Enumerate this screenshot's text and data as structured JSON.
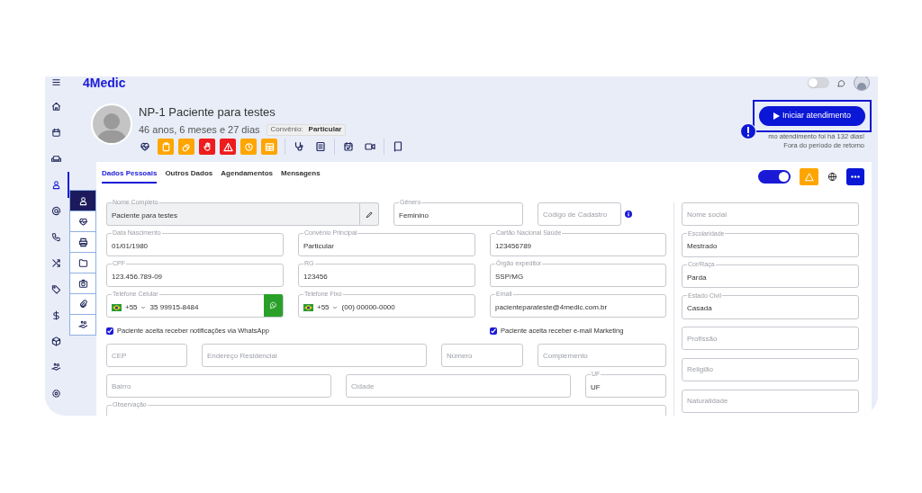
{
  "app": {
    "logo": "4Medic"
  },
  "sidebar": {
    "items": [
      {
        "kind": "menu",
        "selected": false
      },
      {
        "kind": "home",
        "selected": false
      },
      {
        "kind": "calendar",
        "selected": false
      },
      {
        "kind": "sofa",
        "selected": false
      },
      {
        "kind": "user",
        "selected": true
      },
      {
        "kind": "at",
        "selected": false
      },
      {
        "kind": "phone",
        "selected": false
      },
      {
        "kind": "shuffle",
        "selected": false
      },
      {
        "kind": "tag",
        "selected": false
      },
      {
        "kind": "dollar",
        "selected": false
      },
      {
        "kind": "box",
        "selected": false
      },
      {
        "kind": "hand-coins",
        "selected": false
      },
      {
        "kind": "gear",
        "selected": false
      }
    ]
  },
  "topbar": {
    "toggle_on": false
  },
  "patient": {
    "name": "NP-1 Paciente para testes",
    "age": "46 anos, 6 meses e 27 dias",
    "plan_label": "Convênio:",
    "plan": "Particular"
  },
  "quick_actions": [
    [
      {
        "kind": "heart-pulse"
      },
      {
        "kind": "clipboard",
        "color": "#ffa500"
      },
      {
        "kind": "pill",
        "color": "#ffa500"
      },
      {
        "kind": "hand",
        "color": "#ee1c1c"
      },
      {
        "kind": "warning",
        "color": "#ee1c1c"
      },
      {
        "kind": "history",
        "color": "#ffa500"
      },
      {
        "kind": "table",
        "color": "#ffa500"
      }
    ],
    [
      {
        "kind": "stethoscope"
      },
      {
        "kind": "list"
      }
    ],
    [
      {
        "kind": "calendar-check"
      },
      {
        "kind": "video"
      }
    ],
    [
      {
        "kind": "book"
      }
    ]
  ],
  "start_button": {
    "label": "Iniciar atendimento",
    "highlighted": true
  },
  "notice": [
    "mo atendimento foi há 132 dias!",
    "Fora do período de retorno"
  ],
  "tabs": [
    {
      "label": "Dados Pessoais",
      "selected": true
    },
    {
      "label": "Outros Dados",
      "selected": false
    },
    {
      "label": "Agendamentos",
      "selected": false
    },
    {
      "label": "Mensagens",
      "selected": false
    }
  ],
  "panel_controls": {
    "toggle_on": true
  },
  "side_tabs": [
    {
      "kind": "user",
      "selected": true
    },
    {
      "kind": "heart-pulse",
      "selected": false
    },
    {
      "kind": "printer",
      "selected": false
    },
    {
      "kind": "folder",
      "selected": false
    },
    {
      "kind": "camera",
      "selected": false
    },
    {
      "kind": "paperclip",
      "selected": false
    },
    {
      "kind": "hand-coins",
      "selected": false
    }
  ],
  "form": {
    "rows": [
      {
        "kind": "fields",
        "fields": [
          {
            "kind": "locked",
            "label": "Nome Completo",
            "value": "Paciente para testes"
          },
          {
            "kind": "text",
            "label": "Gênero",
            "value": "Feminino"
          },
          {
            "kind": "empty",
            "placeholder": "Código de Cadastro",
            "info": true
          }
        ]
      },
      {
        "kind": "fields",
        "fields": [
          {
            "kind": "text",
            "label": "Data Nascimento",
            "value": "01/01/1980"
          },
          {
            "kind": "text",
            "label": "Convênio Principal",
            "value": "Particular"
          },
          {
            "kind": "text",
            "label": "Cartão Nacional Saúde",
            "value": "123456789"
          }
        ]
      },
      {
        "kind": "fields",
        "fields": [
          {
            "kind": "text",
            "label": "CPF",
            "value": "123.456.789-09"
          },
          {
            "kind": "text",
            "label": "RG",
            "value": "123456"
          },
          {
            "kind": "text",
            "label": "Órgão expeditor",
            "value": "SSP/MG"
          }
        ]
      },
      {
        "kind": "fields",
        "fields": [
          {
            "kind": "phone",
            "label": "Telefone Celular",
            "dial_code": "+55",
            "value": "35 99915-8484",
            "whatsapp": true
          },
          {
            "kind": "phone",
            "label": "Telefone Fixo",
            "dial_code": "+55",
            "value": "(00) 00000-0000",
            "whatsapp": false
          },
          {
            "kind": "text",
            "label": "Email",
            "value": "pacienteparateste@4medic.com.br"
          }
        ]
      },
      {
        "kind": "consents",
        "items": [
          {
            "label": "Paciente aceita receber notificações via WhatsApp",
            "checked": true
          },
          {
            "label": "Paciente aceita receber e-mail Marketing",
            "checked": true
          }
        ]
      },
      {
        "kind": "fields",
        "fields": [
          {
            "kind": "empty",
            "placeholder": "CEP"
          },
          {
            "kind": "empty",
            "placeholder": "Endereço Residencial"
          },
          {
            "kind": "empty",
            "placeholder": "Número"
          },
          {
            "kind": "empty",
            "placeholder": "Complemento"
          }
        ]
      },
      {
        "kind": "fields",
        "fields": [
          {
            "kind": "empty",
            "placeholder": "Bairro"
          },
          {
            "kind": "empty",
            "placeholder": "Cidade"
          },
          {
            "kind": "text",
            "label": "UF",
            "value": "UF"
          }
        ]
      },
      {
        "kind": "fields",
        "fields": [
          {
            "kind": "textarea",
            "label": "Observação"
          }
        ]
      }
    ],
    "side_fields": [
      {
        "kind": "empty",
        "placeholder": "Nome social"
      },
      {
        "kind": "text",
        "label": "Escolaridade",
        "value": "Mestrado"
      },
      {
        "kind": "text",
        "label": "Cor/Raça",
        "value": "Parda"
      },
      {
        "kind": "text",
        "label": "Estado Civil",
        "value": "Casada"
      },
      {
        "kind": "empty",
        "placeholder": "Profissão"
      },
      {
        "kind": "empty",
        "placeholder": "Religião"
      },
      {
        "kind": "empty",
        "placeholder": "Naturalidade"
      }
    ]
  }
}
